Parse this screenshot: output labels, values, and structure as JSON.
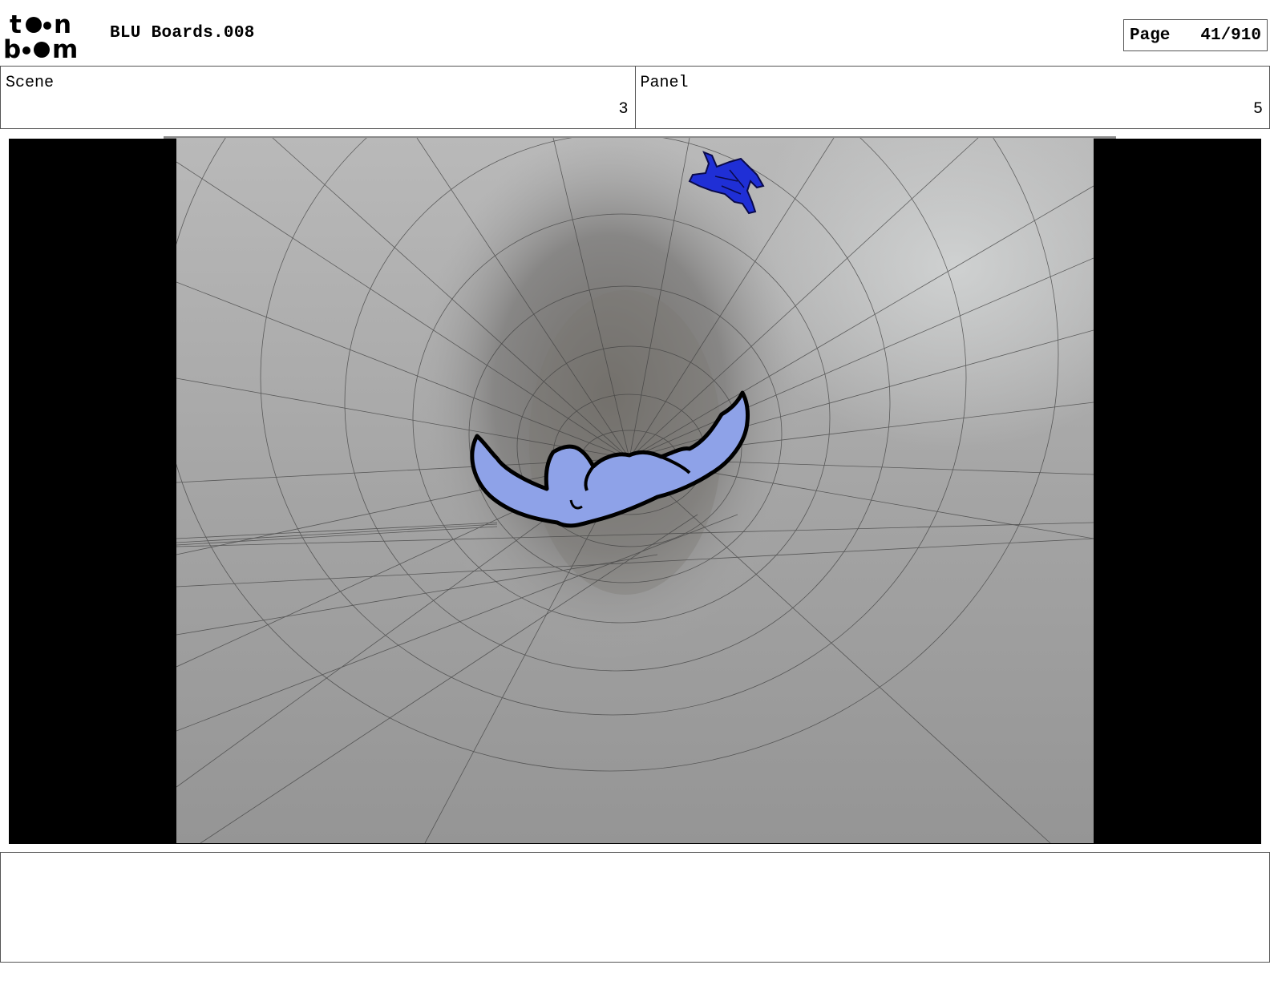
{
  "header": {
    "logo_text": "toon boom",
    "title": "BLU Boards.008",
    "page_label": "Page",
    "page_number": "41/910"
  },
  "scene": {
    "label": "Scene",
    "value": "3"
  },
  "panel": {
    "label": "Panel",
    "value": "5"
  },
  "notes": {
    "text": ""
  }
}
